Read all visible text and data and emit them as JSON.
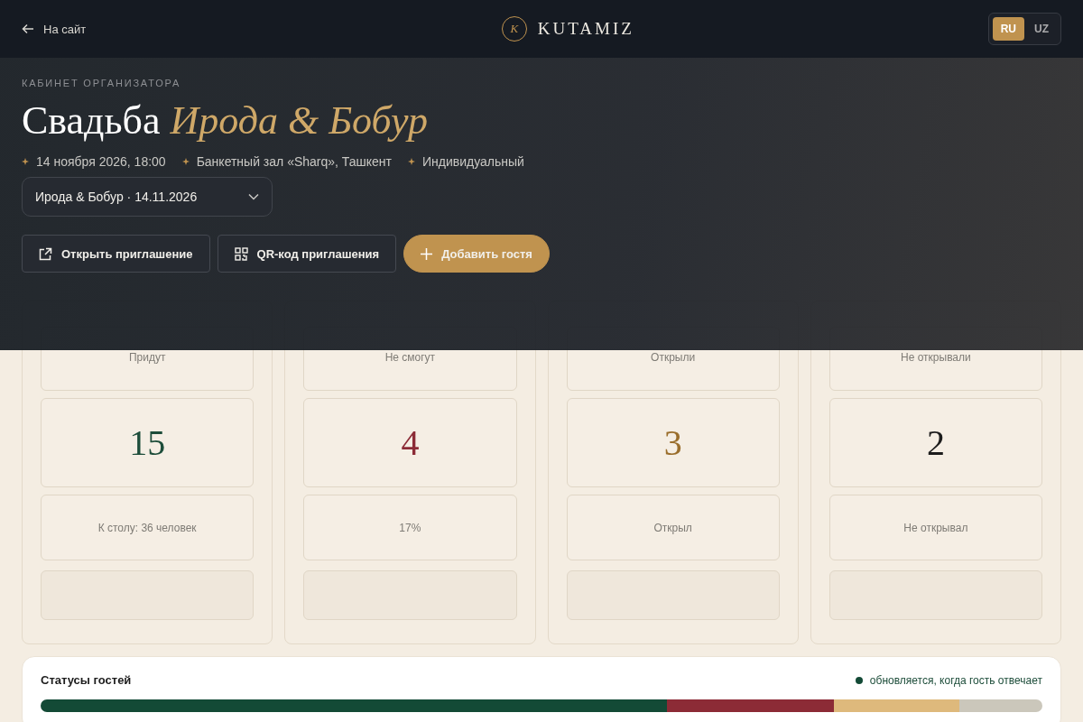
{
  "topbar": {
    "back_link": "На сайт",
    "logo_letter": "K",
    "logo_text": "KUTAMIZ",
    "languages": [
      {
        "label": "RU",
        "selected": true
      },
      {
        "label": "UZ",
        "selected": false
      }
    ]
  },
  "header": {
    "eyebrow": "КАБИНЕТ ОРГАНИЗАТОРА",
    "title": "Свадьба *Ирода & Бобур*",
    "meta": [
      "14 ноября 2026, 18:00",
      "Банкетный зал «Sharq», Ташкент",
      "Индивидуальный"
    ],
    "event_select": {
      "value": "Ирода & Бобур · 14.11.2026"
    },
    "actions": [
      {
        "kind": "link",
        "label": "Открыть приглашение"
      },
      {
        "kind": "qr",
        "label": "QR-код приглашения"
      },
      {
        "kind": "add",
        "label": "Добавить гостя"
      }
    ]
  },
  "stats": [
    {
      "label": "Придут",
      "value": "15",
      "color": "#1d4d3a",
      "note": "К столу: 36 человек"
    },
    {
      "label": "Не смогут",
      "value": "4",
      "color": "#8c2b36",
      "note": "17%"
    },
    {
      "label": "Открыли",
      "value": "3",
      "color": "#9a6e2c",
      "note": "Открыл"
    },
    {
      "label": "Не открывали",
      "value": "2",
      "color": "#1c1c1c",
      "note": "Не открывал"
    }
  ],
  "status_panel": {
    "title": "Статусы гостей",
    "live_note": "обновляется, когда гость отвечает",
    "segments": [
      {
        "color": "#134a36"
      },
      {
        "color": "#8c2b36"
      },
      {
        "color": "#deb97c"
      },
      {
        "color": "#cbc7bb"
      }
    ]
  }
}
